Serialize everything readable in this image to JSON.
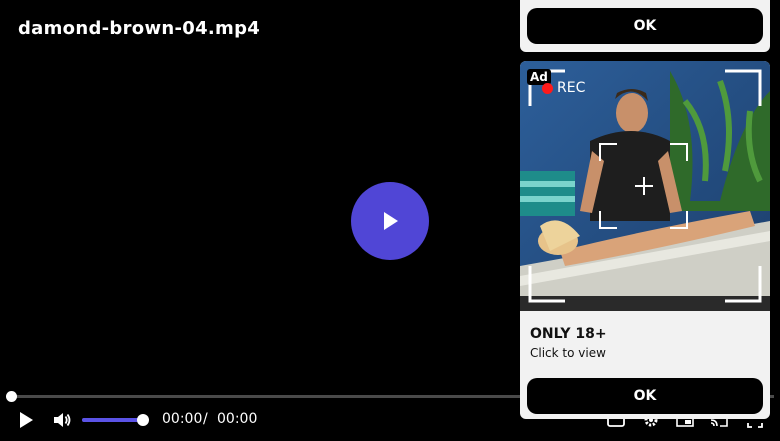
{
  "video": {
    "title": "damond-brown-04.mp4",
    "progress": 0,
    "volume": 1.0,
    "current_time": "00:00",
    "separator": "/",
    "duration": "00:00"
  },
  "icons": {
    "big_play": "play-icon",
    "play": "play-icon",
    "volume": "volume-icon",
    "captions": "captions-icon",
    "settings": "gear-icon",
    "pip": "picture-in-picture-icon",
    "cast": "cast-icon",
    "fullscreen": "fullscreen-icon"
  },
  "colors": {
    "accent": "#5046d6",
    "volume_fill": "#5b53e6",
    "rec_dot": "#ff1a1a",
    "ad_bg": "#f2f2f2"
  },
  "ad": {
    "top_ok_label": "OK",
    "badge": "Ad",
    "rec_label": "REC",
    "headline": "ONLY 18+",
    "subtext": "Click to view",
    "ok_label": "OK"
  }
}
